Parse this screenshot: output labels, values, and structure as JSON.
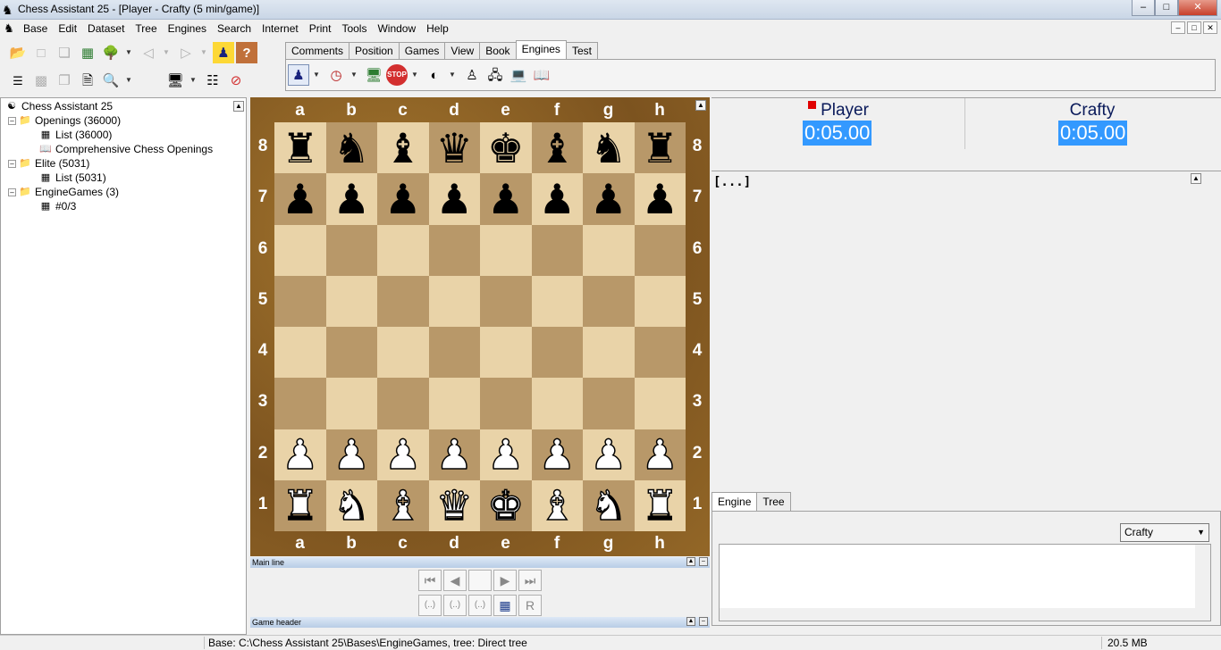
{
  "window": {
    "title": "Chess Assistant 25 - [Player - Crafty (5 min/game)]",
    "buttons": [
      "–",
      "□",
      "✕"
    ]
  },
  "menu": {
    "items": [
      "Base",
      "Edit",
      "Dataset",
      "Tree",
      "Engines",
      "Search",
      "Internet",
      "Print",
      "Tools",
      "Window",
      "Help"
    ]
  },
  "mdi_controls": [
    "–",
    "□",
    "✕"
  ],
  "toolbar": {
    "tabs": [
      "Comments",
      "Position",
      "Games",
      "View",
      "Book",
      "Engines",
      "Test"
    ],
    "active_tab": "Engines"
  },
  "tree": {
    "rows": [
      {
        "label": "Chess Assistant 25",
        "icon": "sitemap-icon"
      },
      {
        "label": "Openings (36000)",
        "icon": "database-folder-icon"
      },
      {
        "label": "List (36000)",
        "icon": "table-icon"
      },
      {
        "label": "Comprehensive Chess Openings",
        "icon": "book-icon"
      },
      {
        "label": "Elite (5031)",
        "icon": "database-folder-icon"
      },
      {
        "label": "List (5031)",
        "icon": "table-icon"
      },
      {
        "label": "EngineGames (3)",
        "icon": "database-folder-icon"
      },
      {
        "label": "#0/3",
        "icon": "table-icon"
      }
    ]
  },
  "board": {
    "files": [
      "a",
      "b",
      "c",
      "d",
      "e",
      "f",
      "g",
      "h"
    ],
    "ranks": [
      "8",
      "7",
      "6",
      "5",
      "4",
      "3",
      "2",
      "1"
    ],
    "rows": [
      [
        "bR",
        "bN",
        "bB",
        "bQ",
        "bK",
        "bB",
        "bN",
        "bR"
      ],
      [
        "bP",
        "bP",
        "bP",
        "bP",
        "bP",
        "bP",
        "bP",
        "bP"
      ],
      [
        "",
        "",
        "",
        "",
        "",
        "",
        "",
        ""
      ],
      [
        "",
        "",
        "",
        "",
        "",
        "",
        "",
        ""
      ],
      [
        "",
        "",
        "",
        "",
        "",
        "",
        "",
        ""
      ],
      [
        "",
        "",
        "",
        "",
        "",
        "",
        "",
        ""
      ],
      [
        "wP",
        "wP",
        "wP",
        "wP",
        "wP",
        "wP",
        "wP",
        "wP"
      ],
      [
        "wR",
        "wN",
        "wB",
        "wQ",
        "wK",
        "wB",
        "wN",
        "wR"
      ]
    ],
    "colors": {
      "light": "#e9d3a8",
      "dark": "#b89869",
      "frame": "#8a5e24"
    }
  },
  "panels": {
    "main_line": "Main line",
    "game_header": "Game header"
  },
  "nav": {
    "annotation_buttons": [
      "(..)",
      "(..)",
      "(..)"
    ],
    "r_button": "R"
  },
  "clock": {
    "white": {
      "name": "Player",
      "time": "0:05.00",
      "to_move": true
    },
    "black": {
      "name": "Crafty",
      "time": "0:05.00"
    },
    "highlight": "#3399ff"
  },
  "notation": {
    "text": "[...]"
  },
  "engine_panel": {
    "tabs": [
      "Engine",
      "Tree"
    ],
    "active_tab": "Engine",
    "selected_engine": "Crafty"
  },
  "status": {
    "main": "Base: C:\\Chess Assistant 25\\Bases\\EngineGames, tree: Direct tree",
    "memory": "20.5 MB"
  }
}
